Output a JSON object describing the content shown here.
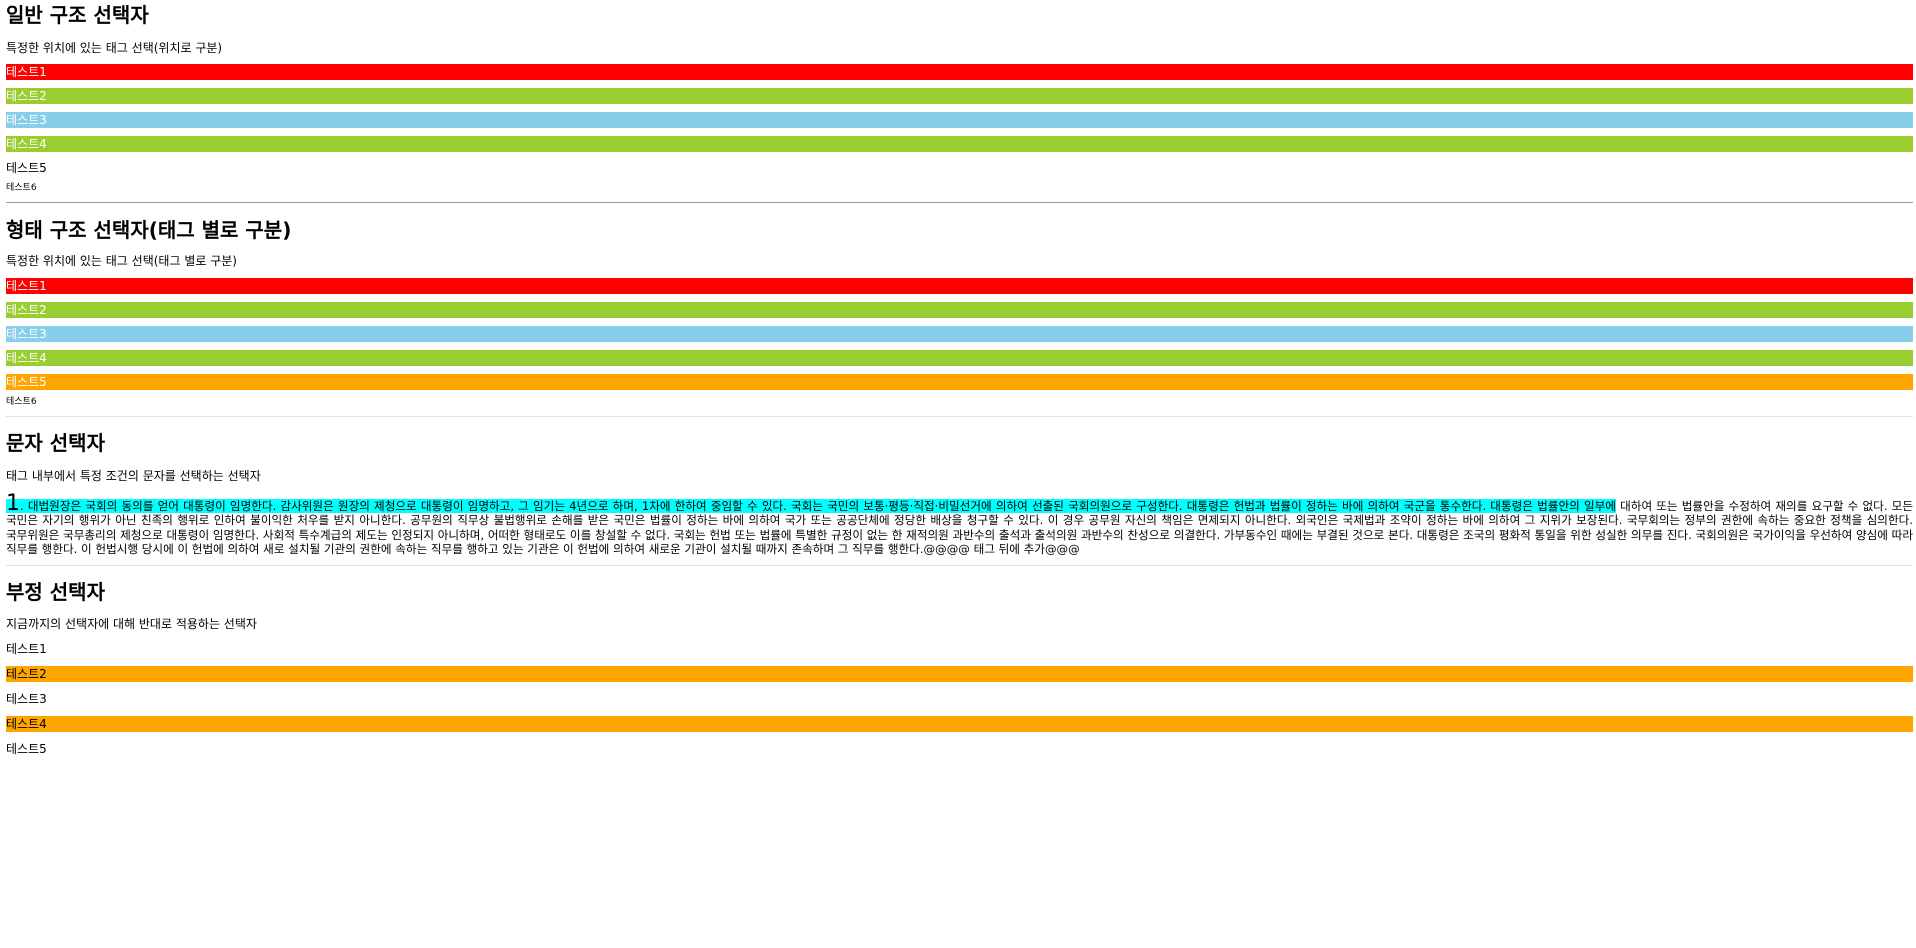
{
  "section1": {
    "title": "일반 구조 선택자",
    "desc": "특정한 위치에 있는 태그 선택(위치로 구분)",
    "items": [
      "테스트1",
      "테스트2",
      "테스트3",
      "테스트4",
      "테스트5",
      "테스트6"
    ]
  },
  "section2": {
    "title": "형태 구조 선택자(태그 별로 구분)",
    "desc": "특정한 위치에 있는 태그 선택(태그 별로 구분)",
    "items": [
      "테스트1",
      "테스트2",
      "테스트3",
      "테스트4",
      "테스트5",
      "테스트6"
    ]
  },
  "section3": {
    "title": "문자 선택자",
    "desc": "태그 내부에서 특정 조건의 문자를 선택하는 선택자",
    "first_letter": "1",
    "first_line": ". 대법원장은 국회의 동의를 얻어 대통령이 임명한다. 감사위원은 원장의 제청으로 대통령이 임명하고, 그 임기는 4년으로 하며, 1차에 한하여 중임할 수 있다. 국회는 국민의 보통·평등·직접·비밀선거에 의하여 선출된 국회의원으로 구성한다. 대통령은 헌법과 법률이 정하는 바에 의하여 국군을 통수한다. 대통령은 법률안의 일부에",
    "rest": "대하여 또는 법률안을 수정하여 재의를 요구할 수 없다. 모든 국민은 자기의 행위가 아닌 친족의 행위로 인하여 불이익한 처우를 받지 아니한다. 공무원의 직무상 불법행위로 손해를 받은 국민은 법률이 정하는 바에 의하여 국가 또는 공공단체에 정당한 배상을 청구할 수 있다. 이 경우 공무원 자신의 책임은 면제되지 아니한다. 외국인은 국제법과 조약이 정하는 바에 의하여 그 지위가 보장된다. 국무회의는 정부의 권한에 속하는 중요한 정책을 심의한다. 국무위원은 국무총리의 제청으로 대통령이 임명한다. 사회적 특수계급의 제도는 인정되지 아니하며, 어떠한 형태로도 이를 창설할 수 없다. 국회는 헌법 또는 법률에 특별한 규정이 없는 한 재적의원 과반수의 출석과 출석의원 과반수의 찬성으로 의결한다. 가부동수인 때에는 부결된 것으로 본다. 대통령은 조국의 평화적 통일을 위한 성실한 의무를 진다. 국회의원은 국가이익을 우선하여 양심에 따라 직무를 행한다. 이 헌법시행 당시에 이 헌법에 의하여 새로 설치될 기관의 권한에 속하는 직무를 행하고 있는 기관은 이 헌법에 의하여 새로운 기관이 설치될 때까지 존속하며 그 직무를 행한다.@@@@ 태그 뒤에 추가@@@"
  },
  "section4": {
    "title": "부정 선택자",
    "desc": "지금까지의 선택자에 대해 반대로 적용하는 선택자",
    "items": [
      "테스트1",
      "테스트2",
      "테스트3",
      "테스트4",
      "테스트5"
    ]
  },
  "colors": {
    "red": "#ff0000",
    "yellowgreen": "#9acd32",
    "skyblue": "#87ceeb",
    "orange": "#ffa500",
    "aqua": "#00ffff"
  }
}
